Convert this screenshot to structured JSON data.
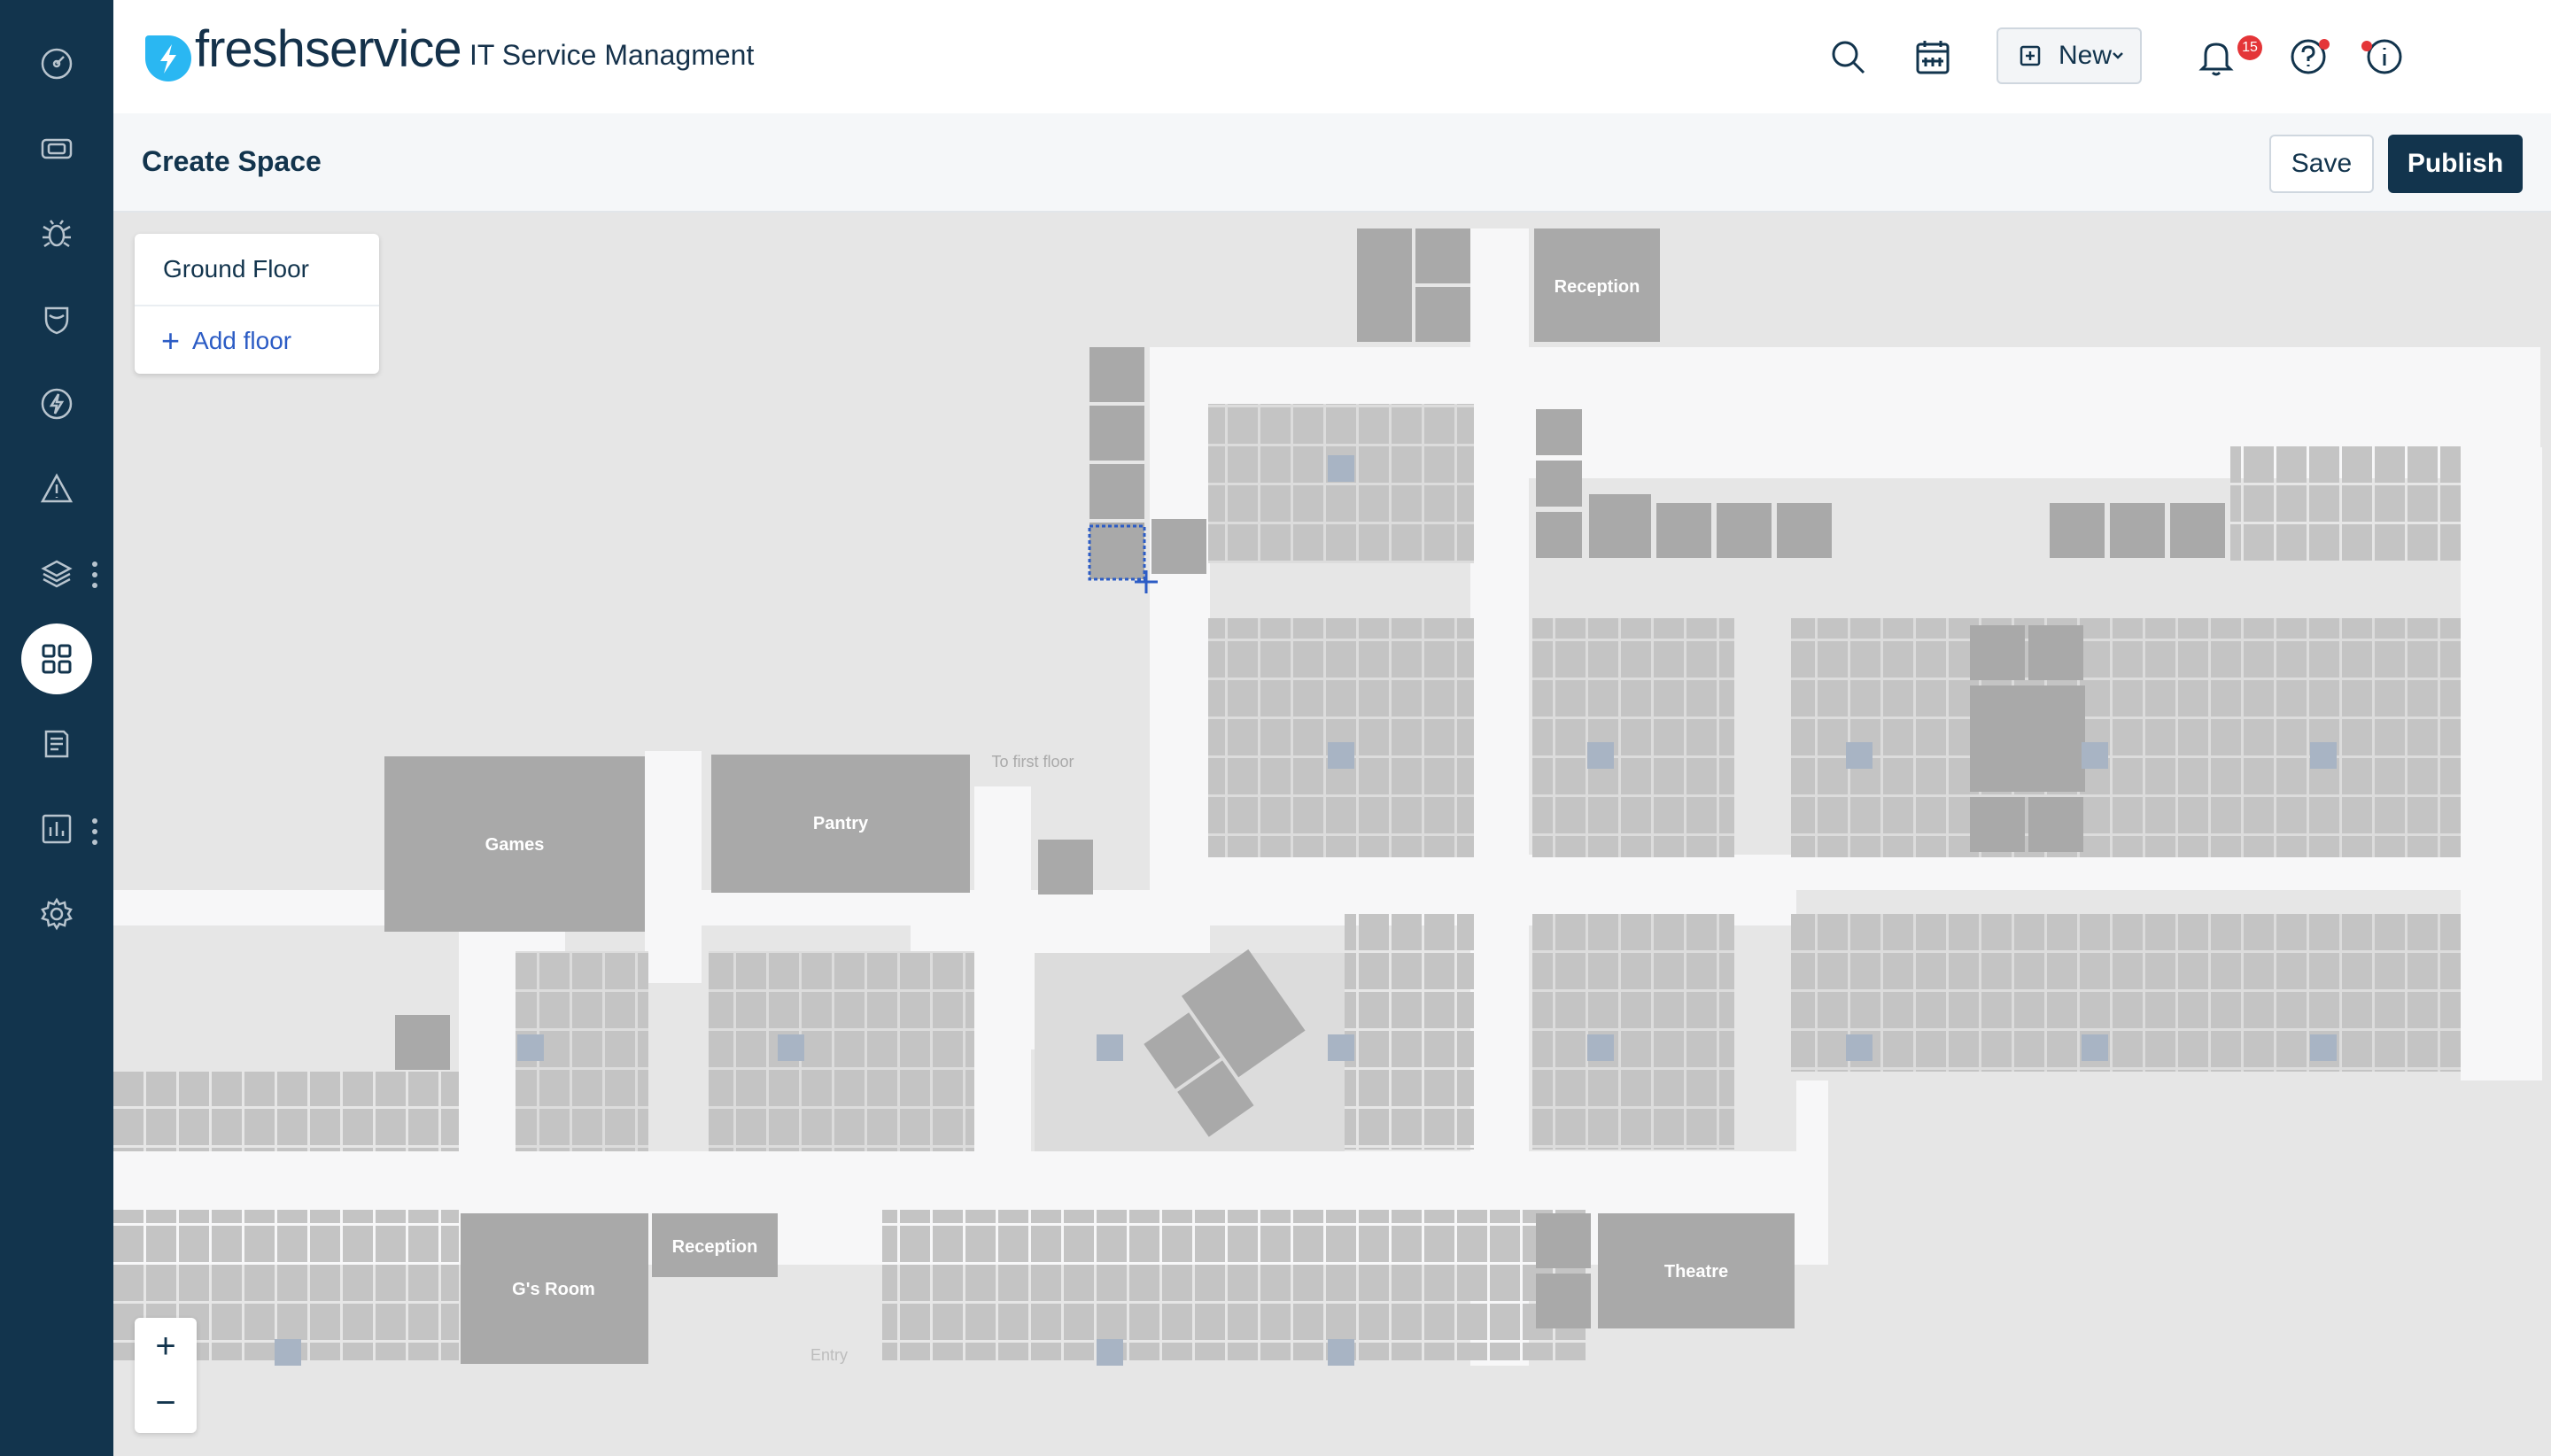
{
  "brand": "freshservice",
  "app_name": "IT Service Managment",
  "header": {
    "new_label": "New",
    "notification_count": "15"
  },
  "subbar": {
    "title": "Create Space",
    "save_label": "Save",
    "publish_label": "Publish"
  },
  "floors": {
    "current": "Ground Floor",
    "add_label": "Add floor"
  },
  "zoom": {
    "in": "+",
    "out": "−"
  },
  "rooms": {
    "reception_top": "Reception",
    "games": "Games",
    "pantry": "Pantry",
    "to_first_floor": "To first floor",
    "reception_bottom": "Reception",
    "gs_room": "G's Room",
    "theatre": "Theatre",
    "entry": "Entry"
  },
  "colors": {
    "sidebar": "#12344d",
    "accent": "#2c5cc5",
    "badge": "#e43538",
    "room": "#a9a9a9",
    "desk": "#c4c4c4",
    "corridor": "#f7f7f8"
  }
}
